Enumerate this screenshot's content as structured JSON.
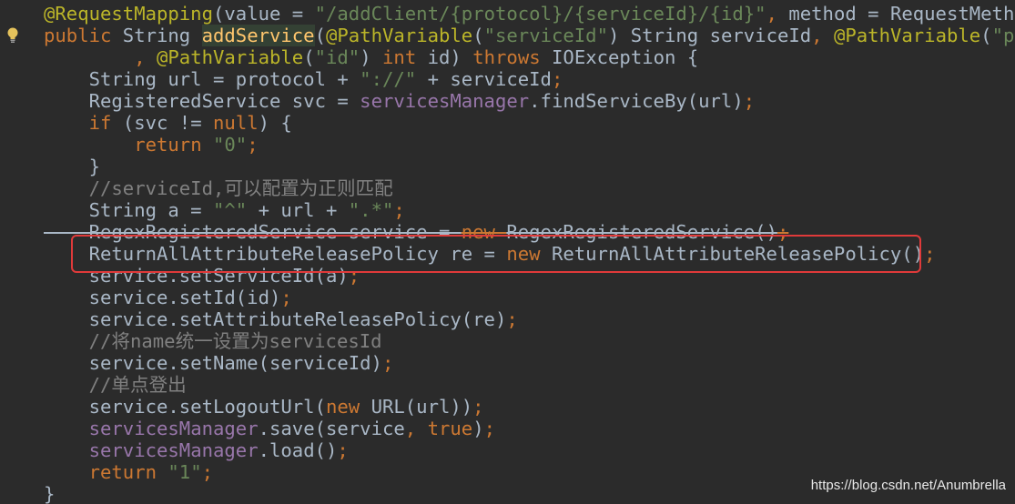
{
  "editor": {
    "lines": [
      [
        {
          "t": "@RequestMapping",
          "c": "anno"
        },
        {
          "t": "(",
          "c": "plain"
        },
        {
          "t": "value",
          "c": "plain"
        },
        {
          "t": " = ",
          "c": "plain"
        },
        {
          "t": "\"/addClient/{protocol}/{serviceId}/{id}\"",
          "c": "str"
        },
        {
          "t": ", ",
          "c": "kw"
        },
        {
          "t": "method",
          "c": "plain"
        },
        {
          "t": " = RequestMethod.",
          "c": "plain"
        }
      ],
      [
        {
          "t": "public ",
          "c": "kw"
        },
        {
          "t": "String ",
          "c": "plain"
        },
        {
          "t": "addService",
          "c": "meth",
          "hl": true
        },
        {
          "t": "(",
          "c": "plain"
        },
        {
          "t": "@PathVariable",
          "c": "anno"
        },
        {
          "t": "(",
          "c": "plain"
        },
        {
          "t": "\"serviceId\"",
          "c": "str"
        },
        {
          "t": ") String serviceId",
          "c": "plain"
        },
        {
          "t": ", ",
          "c": "kw"
        },
        {
          "t": "@PathVariable",
          "c": "anno"
        },
        {
          "t": "(",
          "c": "plain"
        },
        {
          "t": "\"prot",
          "c": "str"
        }
      ],
      [
        {
          "t": "        , ",
          "c": "kw"
        },
        {
          "t": "@PathVariable",
          "c": "anno"
        },
        {
          "t": "(",
          "c": "plain"
        },
        {
          "t": "\"id\"",
          "c": "str"
        },
        {
          "t": ") ",
          "c": "plain"
        },
        {
          "t": "int ",
          "c": "kw"
        },
        {
          "t": "id) ",
          "c": "plain"
        },
        {
          "t": "throws ",
          "c": "kw"
        },
        {
          "t": "IOException {",
          "c": "plain"
        }
      ],
      [
        {
          "t": "    String url = protocol + ",
          "c": "plain"
        },
        {
          "t": "\"://\"",
          "c": "str"
        },
        {
          "t": " + serviceId",
          "c": "plain"
        },
        {
          "t": ";",
          "c": "kw"
        }
      ],
      [
        {
          "t": "    RegisteredService svc = ",
          "c": "plain"
        },
        {
          "t": "servicesManager",
          "c": "field"
        },
        {
          "t": ".findServiceBy(url)",
          "c": "plain"
        },
        {
          "t": ";",
          "c": "kw"
        }
      ],
      [
        {
          "t": "    ",
          "c": "plain"
        },
        {
          "t": "if ",
          "c": "kw"
        },
        {
          "t": "(svc != ",
          "c": "plain"
        },
        {
          "t": "null",
          "c": "kw"
        },
        {
          "t": ") {",
          "c": "plain"
        }
      ],
      [
        {
          "t": "        ",
          "c": "plain"
        },
        {
          "t": "return ",
          "c": "kw"
        },
        {
          "t": "\"0\"",
          "c": "str"
        },
        {
          "t": ";",
          "c": "kw"
        }
      ],
      [
        {
          "t": "    }",
          "c": "plain"
        }
      ],
      [
        {
          "t": "    //serviceId,可以配置为正则匹配",
          "c": "cmt"
        }
      ],
      [
        {
          "t": "    String a = ",
          "c": "plain"
        },
        {
          "t": "\"^\"",
          "c": "str"
        },
        {
          "t": " + url + ",
          "c": "plain"
        },
        {
          "t": "\".*\"",
          "c": "str"
        },
        {
          "t": ";",
          "c": "kw"
        }
      ],
      [
        {
          "t": "    RegexRegisteredService service = ",
          "c": "plain",
          "s": true
        },
        {
          "t": "new ",
          "c": "kw",
          "s": true
        },
        {
          "t": "RegexRegisteredService()",
          "c": "plain",
          "s": true
        },
        {
          "t": ";",
          "c": "kw",
          "s": true
        }
      ],
      [
        {
          "t": "    ReturnAllAttributeReleasePolicy re = ",
          "c": "plain"
        },
        {
          "t": "new ",
          "c": "kw"
        },
        {
          "t": "ReturnAllAttributeReleasePolicy()",
          "c": "plain"
        },
        {
          "t": ";",
          "c": "kw"
        }
      ],
      [
        {
          "t": "    service.setServiceId(a)",
          "c": "plain"
        },
        {
          "t": ";",
          "c": "kw"
        }
      ],
      [
        {
          "t": "    service.setId(id)",
          "c": "plain"
        },
        {
          "t": ";",
          "c": "kw"
        }
      ],
      [
        {
          "t": "    service.setAttributeReleasePolicy(re)",
          "c": "plain"
        },
        {
          "t": ";",
          "c": "kw"
        }
      ],
      [
        {
          "t": "    //将name统一设置为servicesId",
          "c": "cmt"
        }
      ],
      [
        {
          "t": "    service.setName(serviceId)",
          "c": "plain"
        },
        {
          "t": ";",
          "c": "kw"
        }
      ],
      [
        {
          "t": "    //单点登出",
          "c": "cmt"
        }
      ],
      [
        {
          "t": "    service.setLogoutUrl(",
          "c": "plain"
        },
        {
          "t": "new ",
          "c": "kw"
        },
        {
          "t": "URL(url))",
          "c": "plain"
        },
        {
          "t": ";",
          "c": "kw"
        }
      ],
      [
        {
          "t": "    ",
          "c": "plain"
        },
        {
          "t": "servicesManager",
          "c": "field"
        },
        {
          "t": ".save(service",
          "c": "plain"
        },
        {
          "t": ", ",
          "c": "kw"
        },
        {
          "t": "true",
          "c": "kw"
        },
        {
          "t": ")",
          "c": "plain"
        },
        {
          "t": ";",
          "c": "kw"
        }
      ],
      [
        {
          "t": "    ",
          "c": "plain"
        },
        {
          "t": "servicesManager",
          "c": "field"
        },
        {
          "t": ".load()",
          "c": "plain"
        },
        {
          "t": ";",
          "c": "kw"
        }
      ],
      [
        {
          "t": "    ",
          "c": "plain"
        },
        {
          "t": "return ",
          "c": "kw"
        },
        {
          "t": "\"1\"",
          "c": "str"
        },
        {
          "t": ";",
          "c": "kw"
        }
      ],
      [
        {
          "t": "}",
          "c": "plain"
        }
      ]
    ]
  },
  "watermark": "https://blog.csdn.net/Anumbrella",
  "colors": {
    "background": "#2b2b2b",
    "highlight_box": "#e03a3a",
    "keyword": "#cc7832",
    "string": "#6a8759",
    "annotation": "#bbb529",
    "field": "#9876aa",
    "method": "#ffc66d",
    "comment": "#808080",
    "text": "#a9b7c6"
  },
  "icons": {
    "gutter_hint": "lightbulb-icon"
  }
}
